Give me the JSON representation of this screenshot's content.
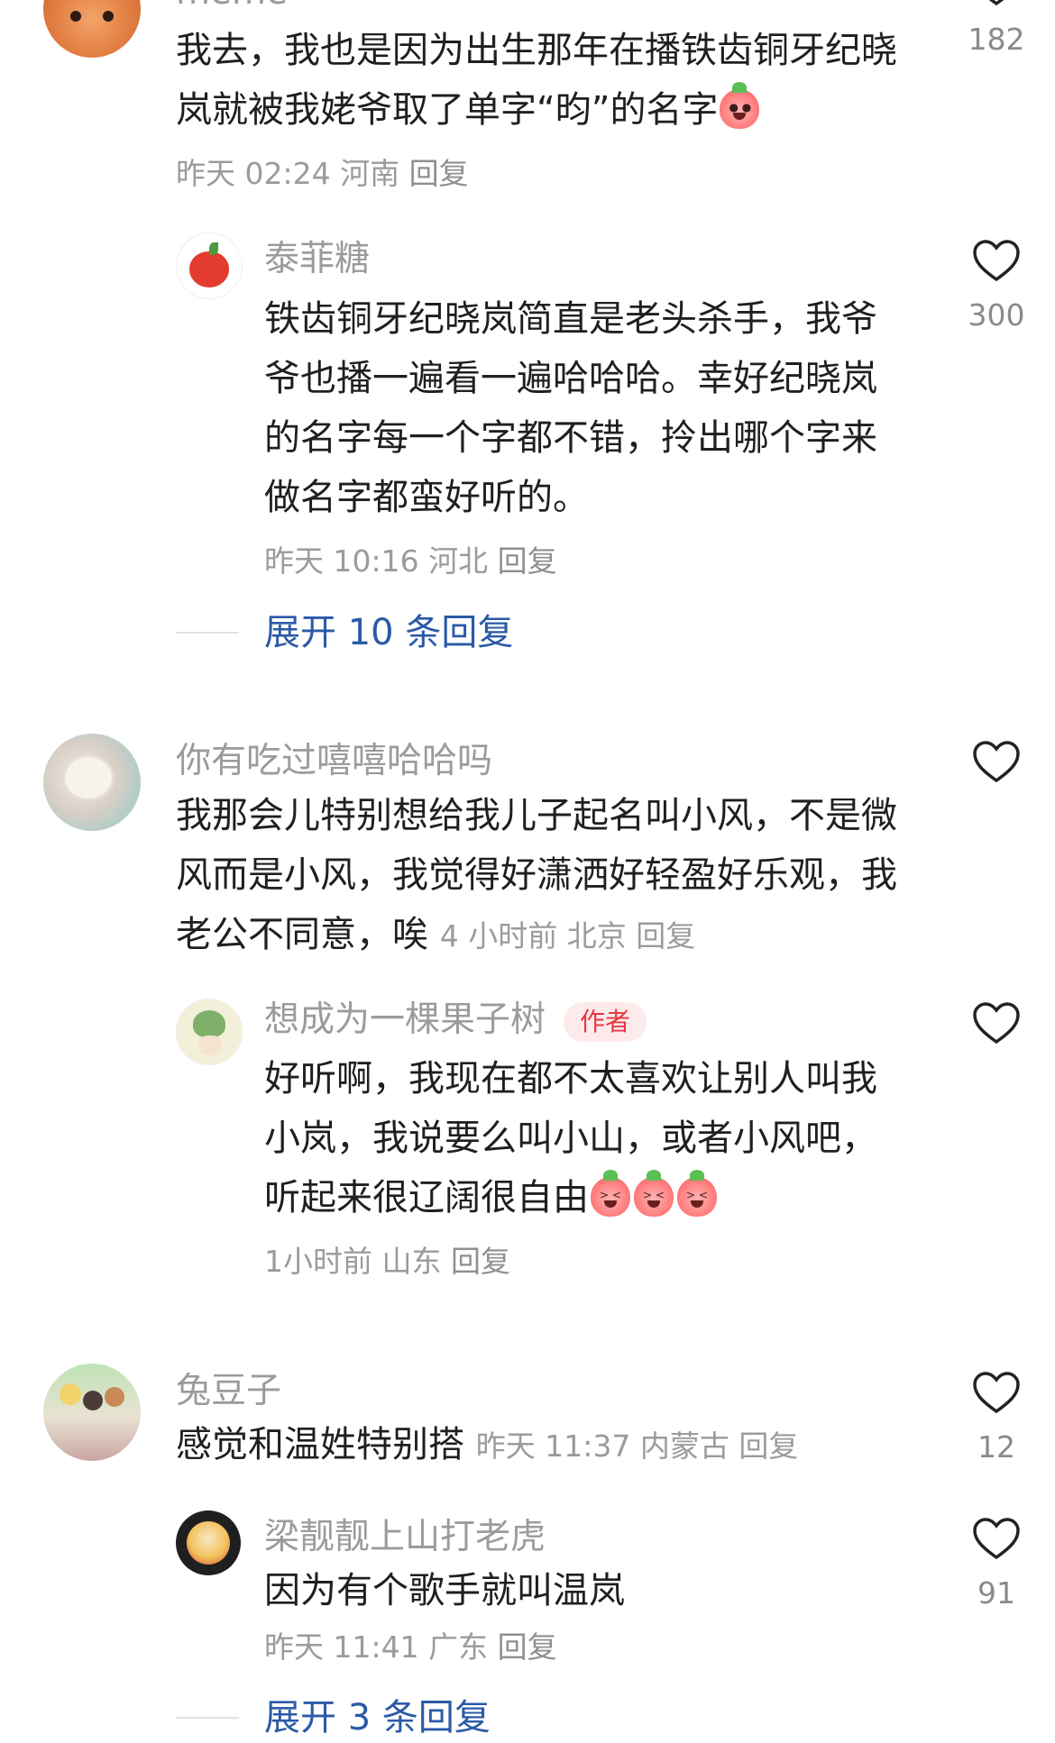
{
  "comments": [
    {
      "name": "meme",
      "text": "我去，我也是因为出生那年在播铁齿铜牙纪晓岚就被我姥爷取了单字“昀”的名字",
      "emoji_count": 1,
      "time": "昨天 02:24",
      "location": "河南",
      "reply_label": "回复",
      "likes": "182",
      "avatar_icon": "goldfish-avatar-icon",
      "replies": [
        {
          "name": "泰菲糖",
          "text": "铁齿铜牙纪晓岚简直是老头杀手，我爷爷也播一遍看一遍哈哈哈。幸好纪晓岚的名字每一个字都不错，拎出哪个字来做名字都蛮好听的。",
          "time": "昨天 10:16",
          "location": "河北",
          "reply_label": "回复",
          "likes": "300",
          "avatar_icon": "apple-avatar-icon"
        }
      ],
      "expand_label": "展开 10 条回复"
    },
    {
      "name": "你有吃过嘻嘻哈哈吗",
      "text": "我那会儿特别想给我儿子起名叫小风，不是微风而是小风，我觉得好潇洒好轻盈好乐观，我老公不同意，唉",
      "time": "4 小时前",
      "location": "北京",
      "reply_label": "回复",
      "likes": "",
      "avatar_icon": "poodle-avatar-icon",
      "replies": [
        {
          "name": "想成为一棵果子树",
          "badge": "作者",
          "text": "好听啊，我现在都不太喜欢让别人叫我小岚，我说要么叫小山，或者小风吧，听起来很辽阔很自由",
          "emoji_count": 3,
          "time": "1小时前",
          "location": "山东",
          "reply_label": "回复",
          "likes": "",
          "avatar_icon": "plant-girl-avatar-icon"
        }
      ]
    },
    {
      "name": "兔豆子",
      "text": "感觉和温姓特别搭",
      "time": "昨天 11:37",
      "location": "内蒙古",
      "reply_label": "回复",
      "likes": "12",
      "avatar_icon": "anime-group-avatar-icon",
      "replies": [
        {
          "name": "梁靓靓上山打老虎",
          "text": "因为有个歌手就叫温岚",
          "time": "昨天 11:41",
          "location": "广东",
          "reply_label": "回复",
          "likes": "91",
          "avatar_icon": "sailor-moon-avatar-icon"
        }
      ],
      "expand_label": "展开 3 条回复"
    }
  ],
  "colors": {
    "name": "#9b9b9b",
    "text": "#1f1f1f",
    "link": "#2b5aa7",
    "badge_bg": "#fdeaea",
    "badge_fg": "#e5363e"
  }
}
